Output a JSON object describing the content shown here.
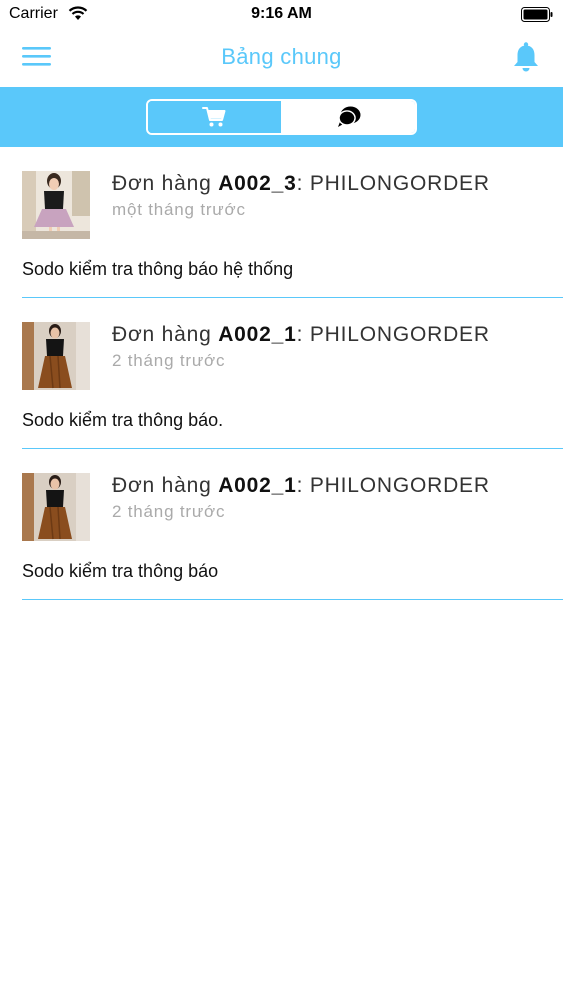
{
  "status_bar": {
    "carrier": "Carrier",
    "time": "9:16 AM"
  },
  "header": {
    "title": "Bảng chung"
  },
  "icons": {
    "menu": "hamburger-menu-icon",
    "bell": "bell-icon",
    "cart": "cart-icon",
    "chat": "chat-bubble-icon"
  },
  "tabs": {
    "active": "chat"
  },
  "colors": {
    "accent": "#5ac8fa",
    "divider": "#5ac8fa"
  },
  "notifications": [
    {
      "prefix": "Đơn hàng ",
      "order_id": "A002_3",
      "suffix": ": PHILONGORDER",
      "time": "một tháng trước",
      "message": "Sodo kiểm tra thông báo hệ thống"
    },
    {
      "prefix": "Đơn hàng ",
      "order_id": "A002_1",
      "suffix": ": PHILONGORDER",
      "time": "2 tháng trước",
      "message": "Sodo kiểm tra thông báo."
    },
    {
      "prefix": "Đơn hàng ",
      "order_id": "A002_1",
      "suffix": ": PHILONGORDER",
      "time": "2 tháng trước",
      "message": "Sodo kiểm tra thông báo"
    }
  ]
}
